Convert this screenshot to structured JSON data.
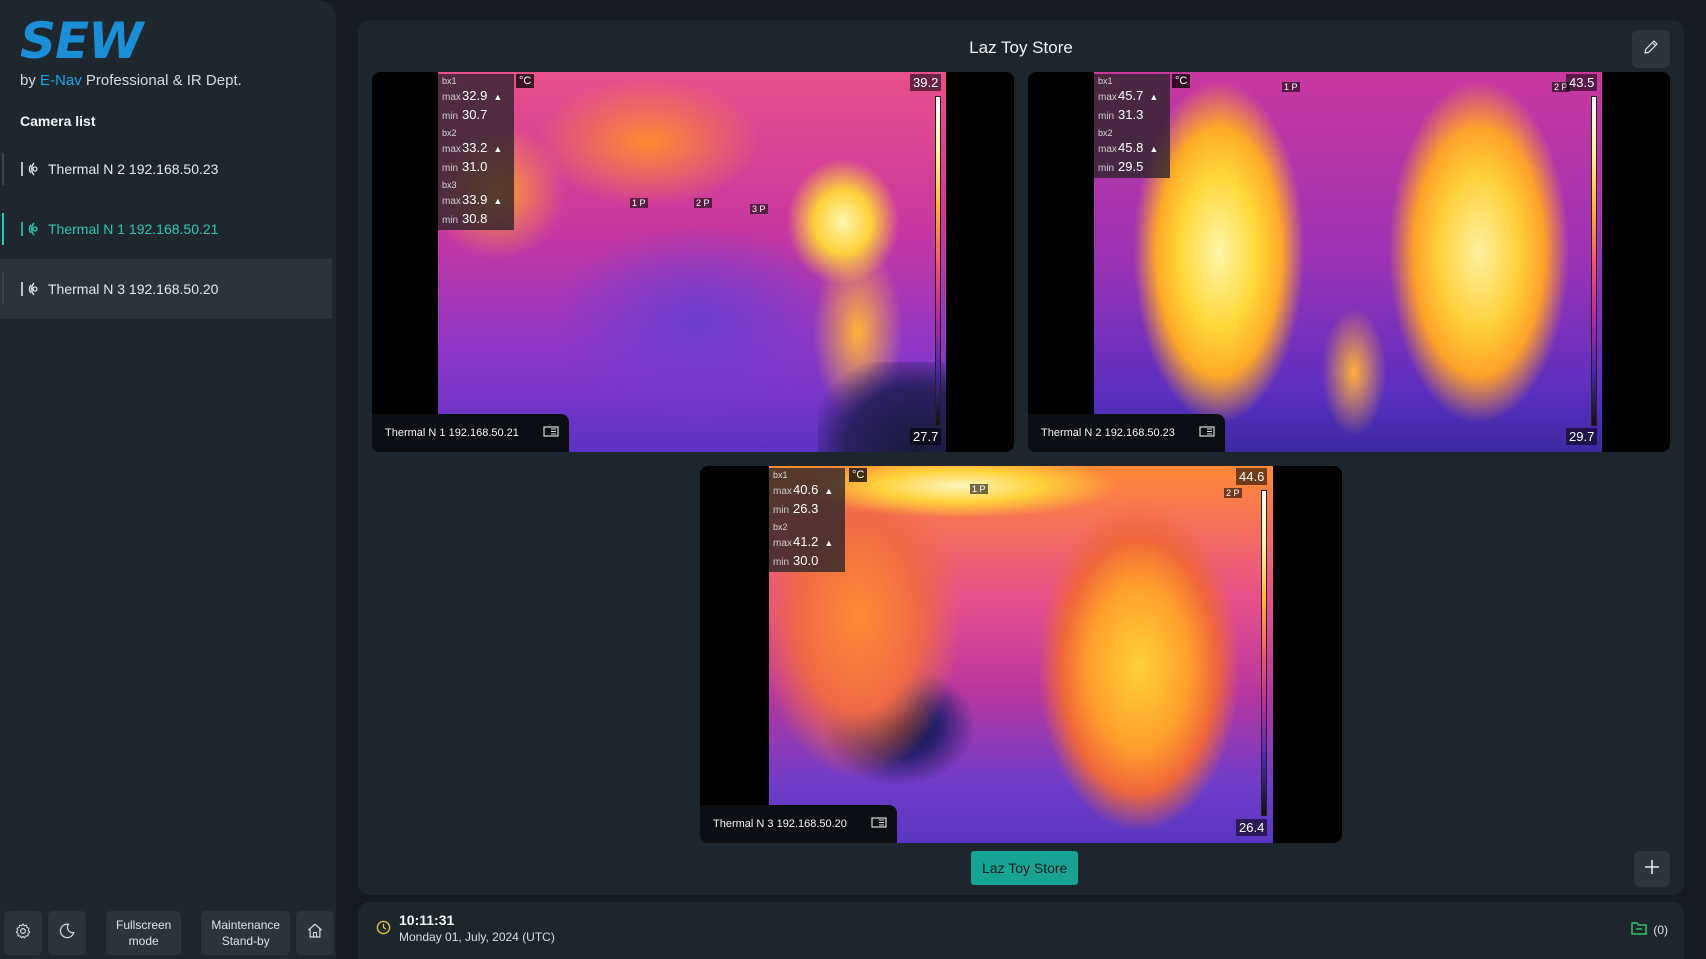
{
  "brand": {
    "logo": "SEW",
    "by": "by",
    "enav": "E-Nav",
    "dept": "Professional & IR Dept."
  },
  "sidebar": {
    "title": "Camera list",
    "cameras": [
      {
        "label": "Thermal N 2 192.168.50.23",
        "state": "normal"
      },
      {
        "label": "Thermal N 1 192.168.50.21",
        "state": "active"
      },
      {
        "label": "Thermal N 3 192.168.50.20",
        "state": "selected"
      }
    ],
    "bottom": {
      "fullscreen_line1": "Fullscreen",
      "fullscreen_line2": "mode",
      "maintenance_line1": "Maintenance",
      "maintenance_line2": "Stand-by"
    }
  },
  "main": {
    "title": "Laz Toy Store",
    "store_button": "Laz Toy Store",
    "tiles": [
      {
        "label": "Thermal N 1 192.168.50.21",
        "max_temp": "39.2",
        "min_temp": "27.7",
        "unit": "°C",
        "boxes": [
          {
            "name": "bx1",
            "max_key": "max",
            "max": "32.9",
            "min_key": "min",
            "min": "30.7"
          },
          {
            "name": "bx2",
            "max_key": "max",
            "max": "33.2",
            "min_key": "min",
            "min": "31.0"
          },
          {
            "name": "bx3",
            "max_key": "max",
            "max": "33.9",
            "min_key": "min",
            "min": "30.8"
          }
        ],
        "markers": [
          "1 P",
          "2 P",
          "3 P"
        ]
      },
      {
        "label": "Thermal N 2 192.168.50.23",
        "max_temp": "43.5",
        "min_temp": "29.7",
        "unit": "°C",
        "boxes": [
          {
            "name": "bx1",
            "max_key": "max",
            "max": "45.7",
            "min_key": "min",
            "min": "31.3"
          },
          {
            "name": "bx2",
            "max_key": "max",
            "max": "45.8",
            "min_key": "min",
            "min": "29.5"
          }
        ],
        "markers": [
          "1 P",
          "2 P"
        ]
      },
      {
        "label": "Thermal N 3 192.168.50.20",
        "max_temp": "44.6",
        "min_temp": "26.4",
        "unit": "°C",
        "boxes": [
          {
            "name": "bx1",
            "max_key": "max",
            "max": "40.6",
            "min_key": "min",
            "min": "26.3"
          },
          {
            "name": "bx2",
            "max_key": "max",
            "max": "41.2",
            "min_key": "min",
            "min": "30.0"
          }
        ],
        "markers": [
          "1 P",
          "2 P"
        ]
      }
    ]
  },
  "footer": {
    "time": "10:11:31",
    "date": "Monday 01, July, 2024 (UTC)",
    "alarm_count": "(0)"
  },
  "colors": {
    "accent": "#17a393",
    "active_text": "#2cc7b4",
    "brand_blue": "#1a8fd6"
  },
  "icons": [
    "thermal-camera-icon",
    "edit-icon",
    "plus-icon",
    "gear-icon",
    "moon-icon",
    "home-icon",
    "clock-icon",
    "folder-status-icon",
    "screen-icon",
    "bell-icon"
  ]
}
